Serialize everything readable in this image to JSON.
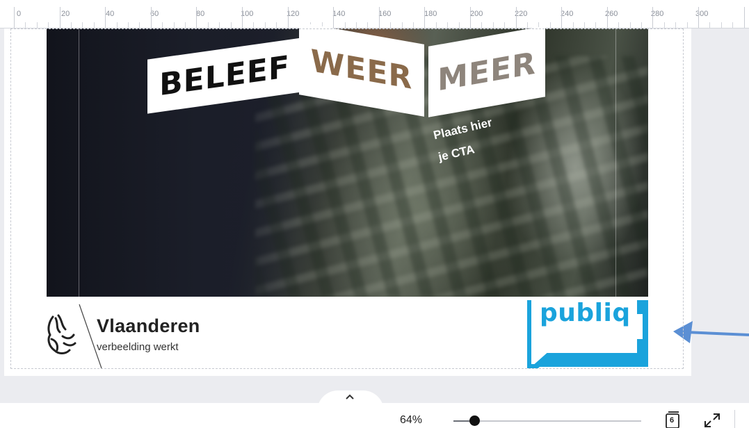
{
  "ruler": {
    "labels": [
      "0",
      "20",
      "40",
      "60",
      "80",
      "100",
      "120",
      "140",
      "160",
      "180",
      "200",
      "220",
      "240",
      "260",
      "280",
      "300"
    ]
  },
  "design": {
    "banner": [
      "BELEEF",
      "WEER",
      "MEER"
    ],
    "cta_line1": "Plaats hier",
    "cta_line2": "je CTA",
    "vlaanderen_name": "Vlaanderen",
    "vlaanderen_tagline": "verbeelding werkt",
    "publiq_logo": "publiq"
  },
  "bottom_bar": {
    "zoom": "64%",
    "zoom_fraction": 0.08,
    "page_count": "6"
  },
  "colors": {
    "publiq_blue": "#1aa3dc",
    "arrow_blue": "#5b8fd4"
  },
  "icons": [
    "collapse-chevron-up-icon",
    "pages-icon",
    "fullscreen-icon",
    "annotation-arrow-icon"
  ]
}
